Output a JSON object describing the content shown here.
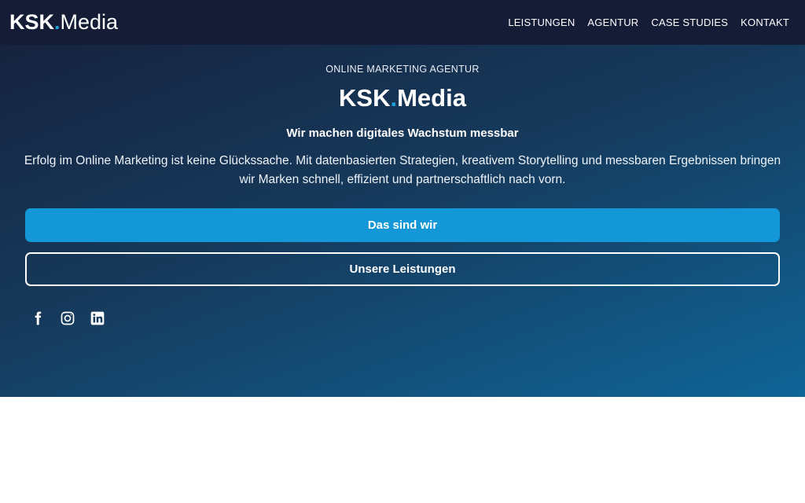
{
  "header": {
    "logo": {
      "ksk": "KSK",
      "dot": ".",
      "media": "Media"
    },
    "nav": [
      "LEISTUNGEN",
      "AGENTUR",
      "CASE STUDIES",
      "KONTAKT"
    ]
  },
  "hero": {
    "eyebrow": "ONLINE MARKETING AGENTUR",
    "logo": {
      "ksk": "KSK",
      "dot": ".",
      "media": "Media"
    },
    "subtitle": "Wir machen digitales Wachstum messbar",
    "lead": "Erfolg im Online Marketing ist keine Glückssache. Mit datenbasierten Strategien, kreativem Storytelling und messbaren Ergebnissen bringen wir Marken schnell, effizient und partnerschaftlich nach vorn.",
    "primary_button": "Das sind wir",
    "secondary_button": "Unsere Leistungen",
    "social_icons": [
      "facebook-icon",
      "instagram-icon",
      "linkedin-icon"
    ]
  },
  "colors": {
    "header_bg": "#151c36",
    "accent": "#1aa0dd",
    "primary_button": "#1497d6",
    "hero_gradient_start": "#16233f",
    "hero_gradient_end": "#0f6598"
  }
}
